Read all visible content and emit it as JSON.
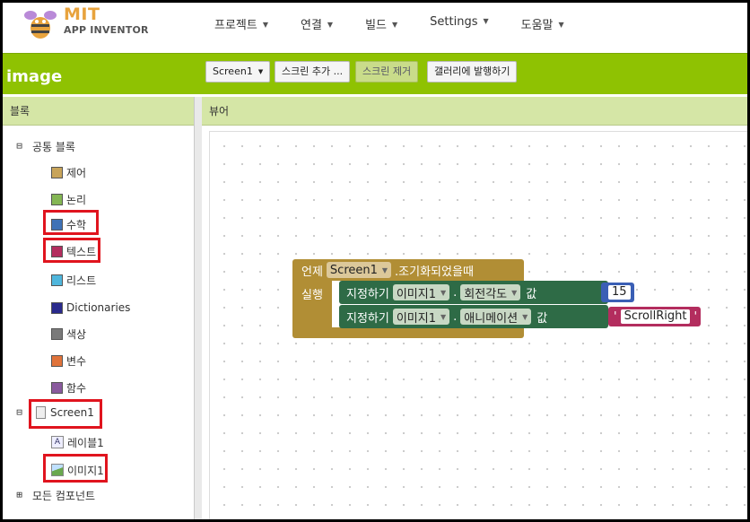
{
  "logo": {
    "mit": "MIT",
    "app_inventor": "APP INVENTOR"
  },
  "menu": [
    {
      "label": "프로젝트"
    },
    {
      "label": "연결"
    },
    {
      "label": "빌드"
    },
    {
      "label": "Settings"
    },
    {
      "label": "도움말"
    }
  ],
  "toolbar": {
    "project_name": "image",
    "screen_select": "Screen1",
    "add_screen": "스크린 추가 ...",
    "remove_screen": "스크린 제거",
    "publish_gallery": "갤러리에 발행하기"
  },
  "blocks_panel": {
    "header": "블록",
    "builtin_label": "공통 블록",
    "builtin_toggle": "⊟",
    "categories": [
      {
        "label": "제어",
        "color": "#c8a45a"
      },
      {
        "label": "논리",
        "color": "#84b654"
      },
      {
        "label": "수학",
        "color": "#3f72b6"
      },
      {
        "label": "텍스트",
        "color": "#b32d5e"
      },
      {
        "label": "리스트",
        "color": "#4fb6dc"
      },
      {
        "label": "Dictionaries",
        "color": "#2a2a8c"
      },
      {
        "label": "색상",
        "color": "#7a7a7a"
      },
      {
        "label": "변수",
        "color": "#e0733a"
      },
      {
        "label": "함수",
        "color": "#8a5a9e"
      }
    ],
    "screen_label": "Screen1",
    "screen_toggle": "⊟",
    "components": [
      {
        "label": "레이블1",
        "icon": "A"
      },
      {
        "label": "이미지1",
        "icon": ""
      }
    ],
    "any_component_label": "모든 컴포넌트",
    "any_component_toggle": "⊞"
  },
  "viewer": {
    "header": "뷰어",
    "event_block": {
      "when": "언제",
      "component": "Screen1",
      "event": ".조기화되었을때",
      "do": "실행"
    },
    "set_block_1": {
      "set": "지정하기",
      "component": "이미지1",
      "dot": ".",
      "property": "회전각도",
      "to": "값",
      "value": "15"
    },
    "set_block_2": {
      "set": "지정하기",
      "component": "이미지1",
      "dot": ".",
      "property": "애니메이션",
      "to": "값",
      "quote_open": "'",
      "value": "ScrollRight",
      "quote_close": "'"
    }
  },
  "colors": {
    "toolbar_green": "#8fc202",
    "panel_header": "#d5e6a6",
    "event_block": "#b18e35",
    "set_block": "#2e6b46",
    "number_block": "#3a5fb5",
    "text_block": "#b32d5e",
    "highlight": "#e0141e"
  }
}
